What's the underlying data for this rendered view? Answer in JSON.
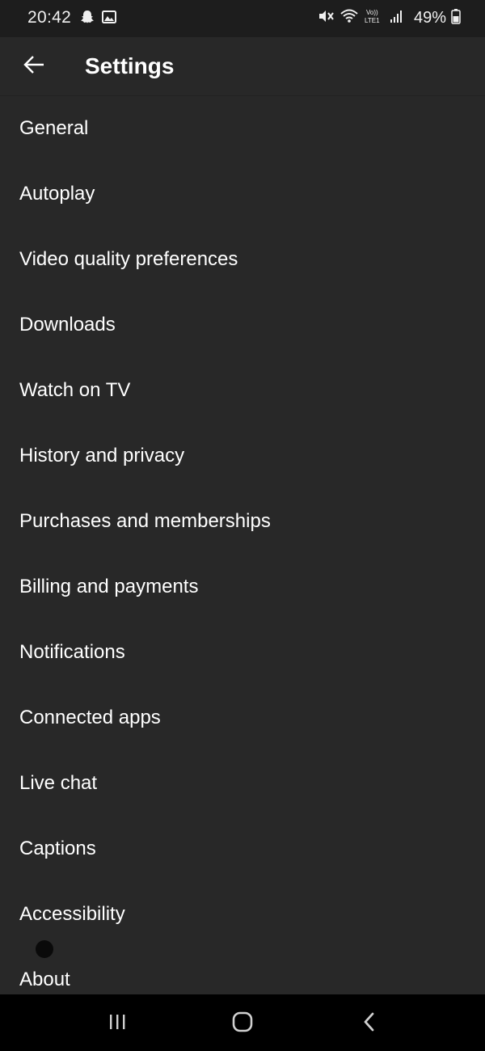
{
  "status_bar": {
    "time": "20:42",
    "battery": "49%",
    "left_icons": [
      "snapchat-icon",
      "image-icon"
    ],
    "right_icons": [
      "mute-icon",
      "wifi-icon",
      "volte-icon",
      "signal-icon",
      "battery-icon"
    ]
  },
  "header": {
    "title": "Settings",
    "back_icon": "arrow-left-icon"
  },
  "settings": {
    "items": [
      "General",
      "Autoplay",
      "Video quality preferences",
      "Downloads",
      "Watch on TV",
      "History and privacy",
      "Purchases and memberships",
      "Billing and payments",
      "Notifications",
      "Connected apps",
      "Live chat",
      "Captions",
      "Accessibility",
      "About"
    ]
  },
  "nav_bar": {
    "buttons": [
      "recent-apps-icon",
      "home-icon",
      "back-icon"
    ]
  },
  "colors": {
    "background": "#282828",
    "status_bar": "#1d1d1d",
    "nav_bar": "#000000",
    "text": "#ffffff"
  }
}
